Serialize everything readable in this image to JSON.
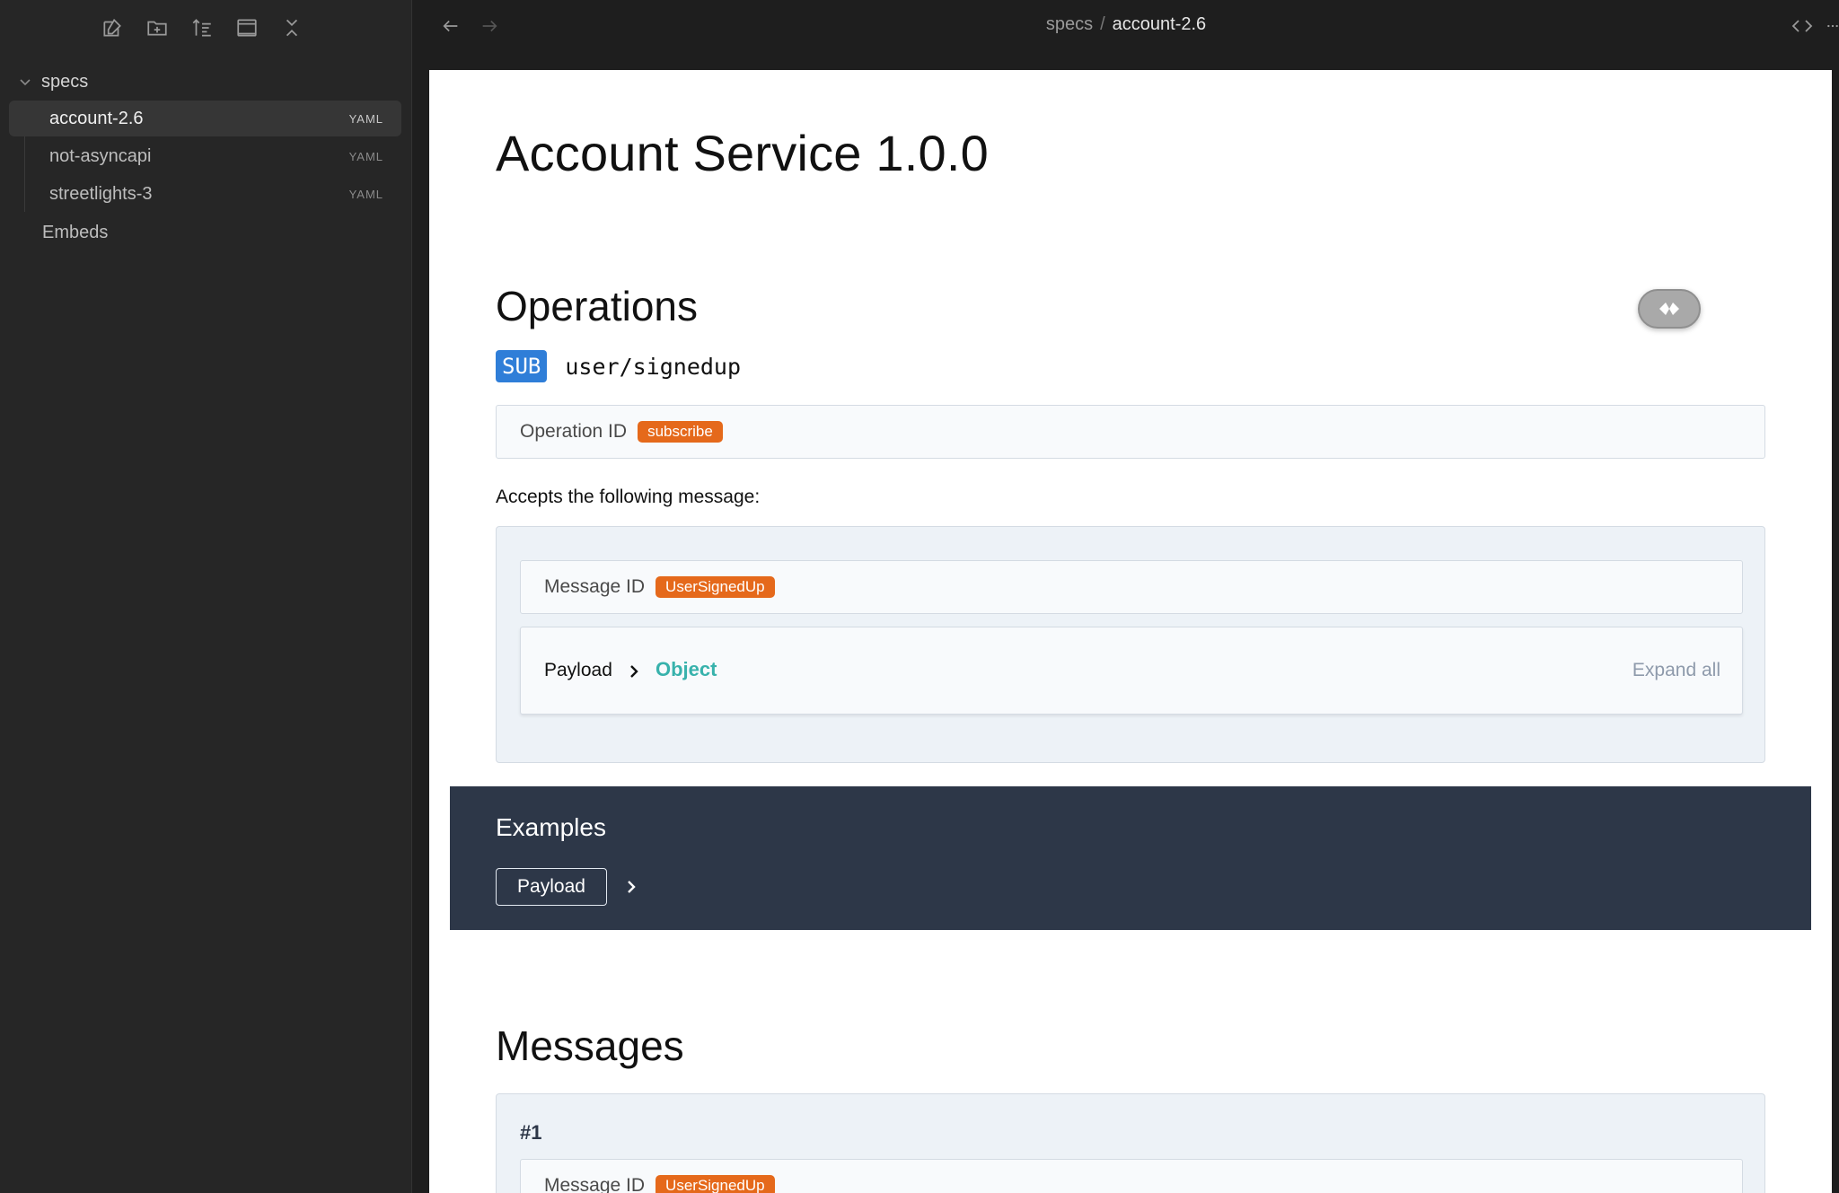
{
  "sidebar": {
    "toolbar": [
      {
        "name": "new-note-icon"
      },
      {
        "name": "new-folder-icon"
      },
      {
        "name": "sort-icon"
      },
      {
        "name": "layout-icon"
      },
      {
        "name": "collapse-all-icon"
      }
    ],
    "folder": {
      "label": "specs",
      "expanded": true
    },
    "items": [
      {
        "label": "account-2.6",
        "tag": "YAML",
        "active": true
      },
      {
        "label": "not-asyncapi",
        "tag": "YAML",
        "active": false
      },
      {
        "label": "streetlights-3",
        "tag": "YAML",
        "active": false
      }
    ],
    "extra_item": {
      "label": "Embeds"
    }
  },
  "topbar": {
    "breadcrumb": {
      "parent": "specs",
      "separator": "/",
      "current": "account-2.6"
    }
  },
  "document": {
    "title": "Account Service 1.0.0",
    "operations": {
      "heading": "Operations",
      "badge": "SUB",
      "channel": "user/signedup",
      "operation_id_label": "Operation ID",
      "operation_id_value": "subscribe",
      "accepts_text": "Accepts the following message:",
      "message_id_label": "Message ID",
      "message_id_value": "UserSignedUp",
      "payload_label": "Payload",
      "payload_type": "Object",
      "expand_all": "Expand all"
    },
    "examples": {
      "heading": "Examples",
      "button": "Payload"
    },
    "messages": {
      "heading": "Messages",
      "number": "#1",
      "message_id_label": "Message ID",
      "message_id_value": "UserSignedUp"
    }
  },
  "colors": {
    "sidebar_bg": "#262626",
    "sub_badge": "#2f7ed8",
    "orange_tag": "#e5691b",
    "object_type": "#38b2ac",
    "examples_bg": "#2d3748"
  }
}
